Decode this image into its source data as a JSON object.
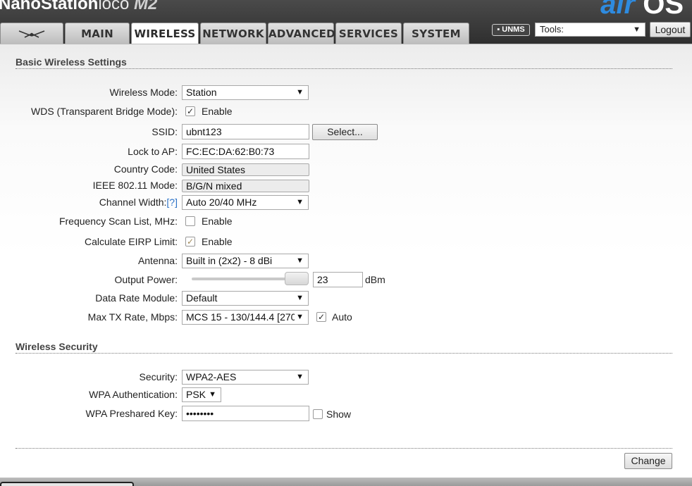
{
  "header": {
    "brand_nano": "NanoStation",
    "brand_loco": "loco",
    "brand_model": "M2",
    "airos_a": "air",
    "airos_os": "OS",
    "tabs": [
      {
        "label": "",
        "icon": "ubiquiti-logo-icon"
      },
      {
        "label": "MAIN"
      },
      {
        "label": "WIRELESS",
        "active": true
      },
      {
        "label": "NETWORK"
      },
      {
        "label": "ADVANCED"
      },
      {
        "label": "SERVICES"
      },
      {
        "label": "SYSTEM"
      }
    ],
    "unms_label": "▪ UNMS",
    "tools_label": "Tools:",
    "logout_label": "Logout"
  },
  "basic": {
    "title": "Basic Wireless Settings",
    "wireless_mode": {
      "label": "Wireless Mode:",
      "value": "Station"
    },
    "wds": {
      "label": "WDS (Transparent Bridge Mode):",
      "option": "Enable",
      "checked": true
    },
    "ssid": {
      "label": "SSID:",
      "value": "ubnt123",
      "button": "Select..."
    },
    "lock_ap": {
      "label": "Lock to AP:",
      "value": "FC:EC:DA:62:B0:73"
    },
    "country": {
      "label": "Country Code:",
      "value": "United States"
    },
    "ieee": {
      "label": "IEEE 802.11 Mode:",
      "value": "B/G/N mixed"
    },
    "channel_width": {
      "label": "Channel Width:",
      "help": "[?]",
      "value": "Auto 20/40 MHz"
    },
    "freq_scan": {
      "label": "Frequency Scan List, MHz:",
      "option": "Enable",
      "checked": false
    },
    "eirp": {
      "label": "Calculate EIRP Limit:",
      "option": "Enable",
      "checked": true
    },
    "antenna": {
      "label": "Antenna:",
      "value": "Built in (2x2) - 8 dBi"
    },
    "output_power": {
      "label": "Output Power:",
      "value": "23",
      "unit": "dBm"
    },
    "data_rate_module": {
      "label": "Data Rate Module:",
      "value": "Default"
    },
    "max_tx": {
      "label": "Max TX Rate, Mbps:",
      "value": "MCS 15 - 130/144.4 [270",
      "auto_label": "Auto",
      "auto_checked": true
    }
  },
  "security": {
    "title": "Wireless Security",
    "security": {
      "label": "Security:",
      "value": "WPA2-AES"
    },
    "wpa_auth": {
      "label": "WPA Authentication:",
      "value": "PSK"
    },
    "psk": {
      "label": "WPA Preshared Key:",
      "value": "••••••••",
      "show_label": "Show",
      "show_checked": false
    }
  },
  "actions": {
    "change_label": "Change"
  },
  "colors": {
    "accent": "#2e8be0",
    "header_bg": "#3a3a3a",
    "help_link": "#2d73c7"
  }
}
